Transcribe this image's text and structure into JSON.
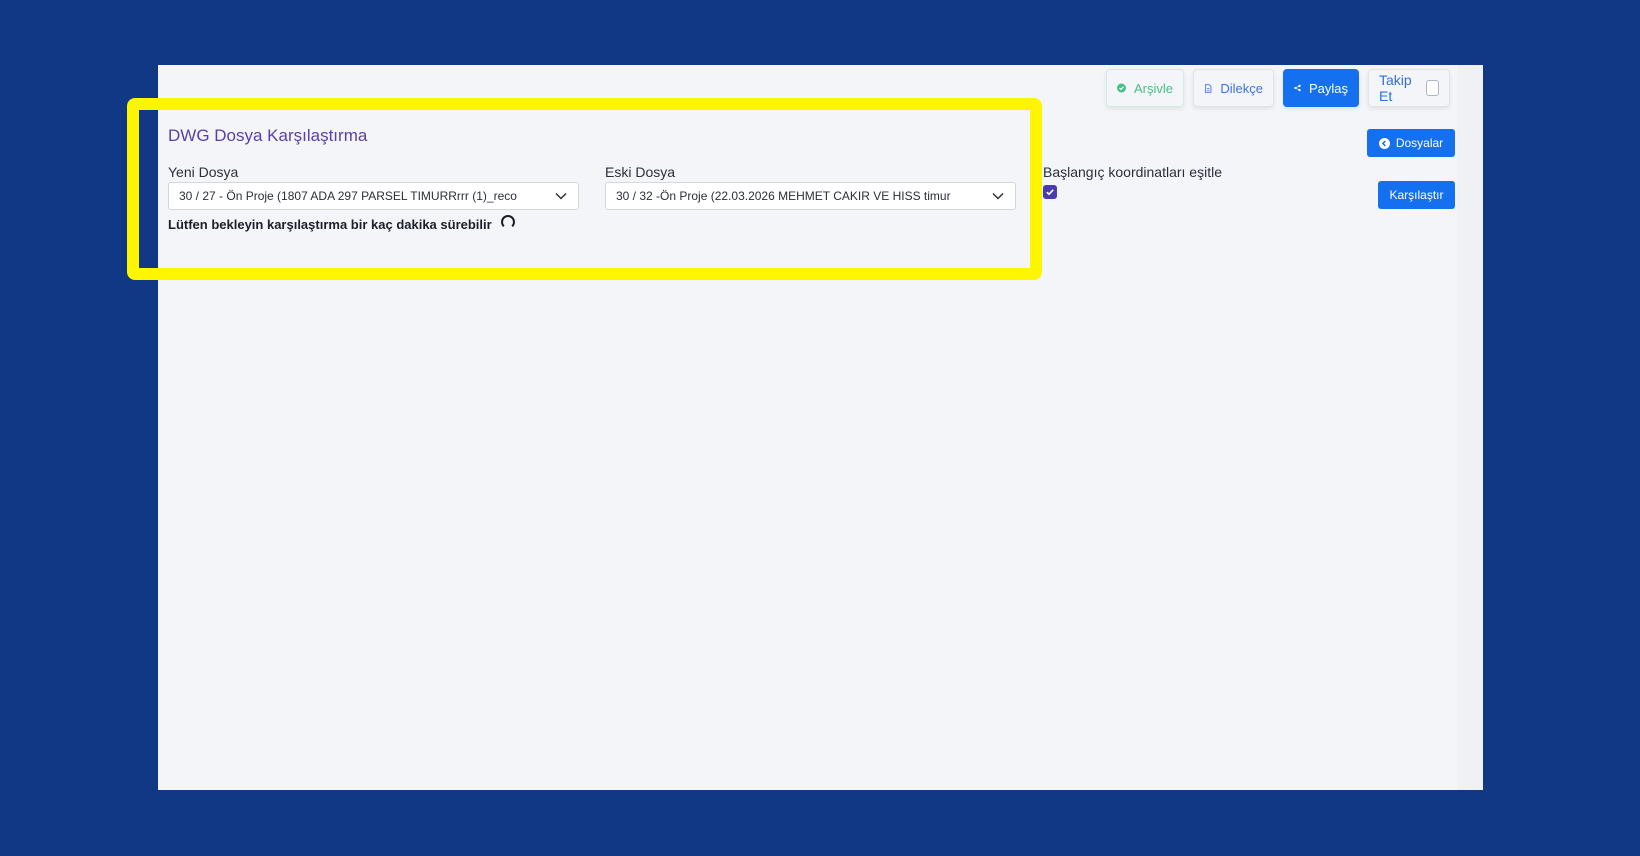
{
  "toolbar": {
    "archive_label": "Arşivle",
    "petition_label": "Dilekçe",
    "share_label": "Paylaş",
    "follow_label": "Takip Et",
    "follow_checked": false
  },
  "actions": {
    "files_label": "Dosyalar",
    "compare_label": "Karşılaştır"
  },
  "form": {
    "title": "DWG Dosya Karşılaştırma",
    "new_file_label": "Yeni Dosya",
    "new_file_value": "30 / 27 - Ön Proje (1807 ADA 297 PARSEL TIMURRrrr (1)_reco",
    "old_file_label": "Eski Dosya",
    "old_file_value": "30 / 32 -Ön Proje (22.03.2026 MEHMET CAKIR VE HISS timur",
    "sync_coords_label": "Başlangıç koordinatları eşitle",
    "sync_coords_checked": true,
    "wait_message": "Lütfen bekleyin karşılaştırma bir kaç dakika sürebilir"
  },
  "colors": {
    "page_background": "#113884",
    "primary": "#1570ef",
    "title": "#5b3fa6",
    "archive_green": "#46c087",
    "checkbox": "#4b3bb0",
    "highlight": "#fdf600"
  }
}
